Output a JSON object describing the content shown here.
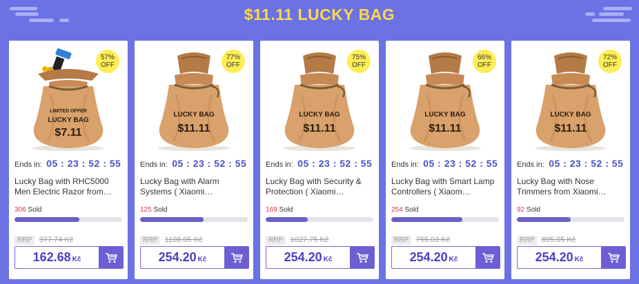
{
  "title": "$11.11 LUCKY BAG",
  "labels": {
    "ends_in": "Ends in:",
    "sold": "Sold",
    "rrp": "RRP"
  },
  "colors": {
    "background": "#6b72e3",
    "title": "#ffd84a",
    "accent": "#6d5fd3",
    "sold_number": "#e6304b",
    "badge": "#ffed55"
  },
  "icons": {
    "cart": "shopping-cart-icon",
    "bag": "lucky-bag-image"
  },
  "products": [
    {
      "discount": "57%",
      "off": "OFF",
      "countdown": "05 : 23 : 52 : 55",
      "name": "Lucky Bag with RHC5000 Men Electric Razor from…",
      "sold": "306",
      "sold_progress": 0.6,
      "rrp": "377.74 Kč",
      "price": "162.68",
      "currency": "Kč",
      "bag_price": "$7.11",
      "bag_label": "LUCKY BAG",
      "bag_extra": "LIMITED OFFER"
    },
    {
      "discount": "77%",
      "off": "OFF",
      "countdown": "05 : 23 : 52 : 55",
      "name": "Lucky Bag with Alarm Systems ( Xiaomi…",
      "sold": "125",
      "sold_progress": 0.59,
      "rrp": "1108.05 Kč",
      "price": "254.20",
      "currency": "Kč",
      "bag_price": "$11.11",
      "bag_label": "LUCKY BAG",
      "bag_extra": ""
    },
    {
      "discount": "75%",
      "off": "OFF",
      "countdown": "05 : 23 : 52 : 55",
      "name": "Lucky Bag with Security & Protection ( Xiaomi…",
      "sold": "169",
      "sold_progress": 0.39,
      "rrp": "1027.75 Kč",
      "price": "254.20",
      "currency": "Kč",
      "bag_price": "$11.11",
      "bag_label": "LUCKY BAG",
      "bag_extra": ""
    },
    {
      "discount": "66%",
      "off": "OFF",
      "countdown": "05 : 23 : 52 : 55",
      "name": "Lucky Bag with Smart Lamp Controllers ( Xiaom…",
      "sold": "254",
      "sold_progress": 0.66,
      "rrp": "755.03 Kč",
      "price": "254.20",
      "currency": "Kč",
      "bag_price": "$11.11",
      "bag_label": "LUCKY BAG",
      "bag_extra": ""
    },
    {
      "discount": "72%",
      "off": "OFF",
      "countdown": "05 : 23 : 52 : 55",
      "name": "Lucky Bag with Nose Trimmers from Xiaomi…",
      "sold": "92",
      "sold_progress": 0.5,
      "rrp": "895.05 Kč",
      "price": "254.20",
      "currency": "Kč",
      "bag_price": "$11.11",
      "bag_label": "LUCKY BAG",
      "bag_extra": ""
    }
  ]
}
